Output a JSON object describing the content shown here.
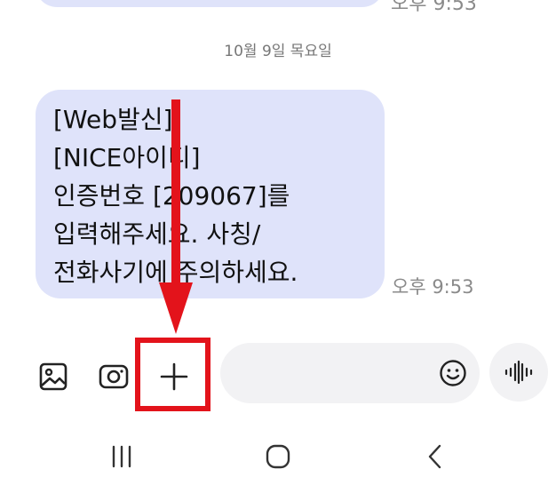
{
  "conversation": {
    "date_divider": "10월 9일 목요일",
    "previous_message": {
      "time": "오후 9:53"
    },
    "message": {
      "lines": [
        "[Web발신]",
        "[NICE아이디]",
        "인증번호 [209067]를",
        "입력해주세요. 사칭/",
        "전화사기에 주의하세요."
      ],
      "time": "오후 9:53"
    }
  },
  "composer": {
    "gallery_icon": "gallery-icon",
    "camera_icon": "camera-icon",
    "attach_icon": "plus-icon",
    "input_value": "",
    "input_placeholder": "",
    "emoji_icon": "emoji-icon",
    "voice_icon": "voice-waveform-icon"
  },
  "annotation": {
    "highlight_color": "#e3131b"
  },
  "navigation": {
    "recents_icon": "recents-icon",
    "home_icon": "home-icon",
    "back_icon": "back-icon"
  }
}
